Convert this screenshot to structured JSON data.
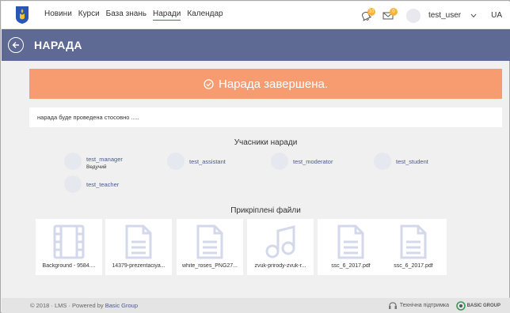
{
  "nav": {
    "items": [
      {
        "label": "Новини"
      },
      {
        "label": "Курси"
      },
      {
        "label": "База знань"
      },
      {
        "label": "Наради"
      },
      {
        "label": "Календар"
      }
    ],
    "active_index": 3,
    "bell_badge": "10",
    "mail_badge": "0",
    "username": "test_user",
    "language": "UA"
  },
  "header": {
    "title": "НАРАДА"
  },
  "banner": {
    "text": "Нарада завершена.",
    "color": "#f79c70"
  },
  "description": "нарада буде проведена стосовно .....",
  "participants": {
    "title": "Учасники наради",
    "items": [
      {
        "name": "test_manager",
        "role": "Ведучий"
      },
      {
        "name": "test_assistant",
        "role": ""
      },
      {
        "name": "test_moderator",
        "role": ""
      },
      {
        "name": "test_student",
        "role": ""
      },
      {
        "name": "test_teacher",
        "role": ""
      }
    ]
  },
  "files": {
    "title": "Прикріплені файли",
    "items": [
      {
        "name": "Background - 9584....",
        "icon": "video-file-icon"
      },
      {
        "name": "14379-prezentaciya...",
        "icon": "document-file-icon"
      },
      {
        "name": "white_roses_PNG27...",
        "icon": "document-file-icon"
      },
      {
        "name": "zvuk-prirody-zvuk-r...",
        "icon": "audio-file-icon"
      },
      {
        "name": "ssc_6_2017.pdf",
        "icon": "document-file-icon"
      },
      {
        "name": "ssc_6_2017.pdf",
        "icon": "document-file-icon"
      }
    ]
  },
  "footer": {
    "copyright": "© 2018 · LMS · Powered by",
    "brand": "Basic Group",
    "support": "Технічна підтримка",
    "logo_text": "BASIC GROUP"
  },
  "colors": {
    "header_bg": "#5e6a93",
    "accent": "#4a5a8e",
    "badge": "#f5b23e"
  }
}
